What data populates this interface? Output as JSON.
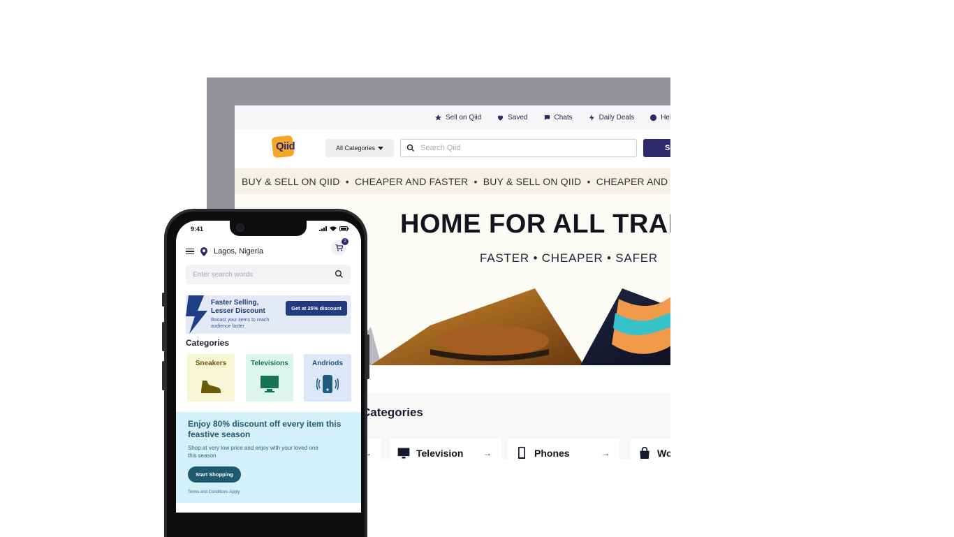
{
  "desktop": {
    "topbar": {
      "items": [
        {
          "label": "Sell on Qiid",
          "icon": "star-icon"
        },
        {
          "label": "Saved",
          "icon": "heart-icon"
        },
        {
          "label": "Chats",
          "icon": "chat-icon"
        },
        {
          "label": "Daily Deals",
          "icon": "lightning-icon"
        },
        {
          "label": "Help",
          "icon": "help-icon"
        }
      ]
    },
    "header": {
      "logo_text": "Qiid",
      "category_select": "All Categories",
      "search_placeholder": "Search Qiid",
      "search_button": "Search"
    },
    "marquee": "BUY & SELL ON QIID  •  CHEAPER AND FASTER  •  BUY & SELL ON QIID  •  CHEAPER AND FASTER",
    "hero": {
      "title": "HOME FOR ALL TRADERS",
      "subtitle": "FASTER • CHEAPER • SAFER"
    },
    "categories": {
      "title": "Categories",
      "items": [
        {
          "label": "Television",
          "icon": "monitor-icon"
        },
        {
          "label": "Phones",
          "icon": "phone-icon"
        },
        {
          "label": "Wo",
          "icon": "shopping-bag-icon"
        }
      ]
    },
    "colors": {
      "brand_primary": "#2f2a6b",
      "logo_orange": "#f4a62a",
      "frame_gray": "#949298"
    }
  },
  "mobile": {
    "status": {
      "time": "9:41"
    },
    "location": "Lagos, Nigeria",
    "cart_count": "2",
    "search_placeholder": "Enter search words",
    "promo": {
      "title": "Faster Selling, Lesser Discount",
      "description": "Booast your items to reach audience faster",
      "button": "Get at 25% discount"
    },
    "categories": {
      "title": "Categories",
      "items": [
        {
          "label": "Sneakers",
          "icon": "sneaker-icon",
          "bg": "#f7f7d8",
          "fg": "#6b5a08"
        },
        {
          "label": "Televisions",
          "icon": "monitor-icon",
          "bg": "#dcf6ee",
          "fg": "#157356"
        },
        {
          "label": "Andriods",
          "icon": "phone-vibrate-icon",
          "bg": "#dce8f7",
          "fg": "#1f5a80"
        }
      ]
    },
    "deal": {
      "title": "Enjoy 80% discount off every item this feastive season",
      "description": "Shop at very low price and enjoy with your loved one this season",
      "button": "Start Shopping",
      "terms": "Terms and Conditions Apply"
    }
  }
}
